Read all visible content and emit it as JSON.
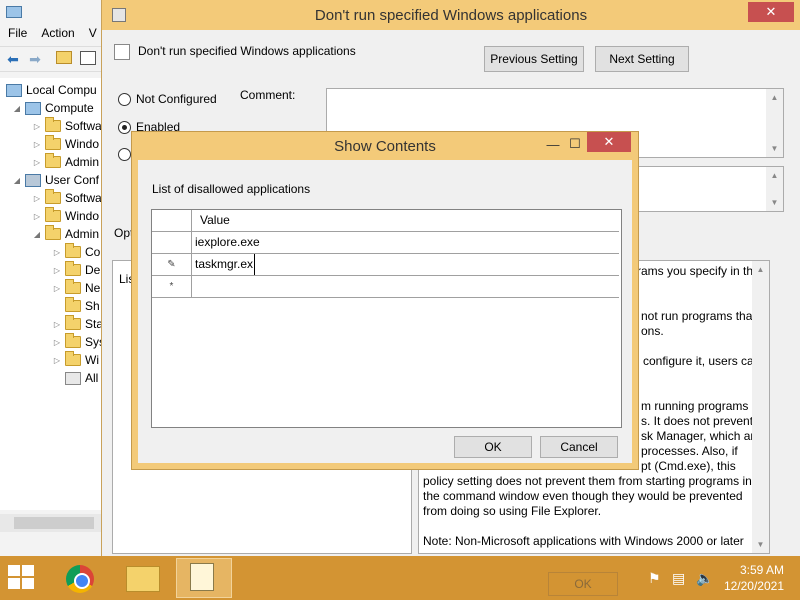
{
  "mmc": {
    "menu": [
      "File",
      "Action",
      "V"
    ],
    "tree": [
      {
        "label": "Local Compu",
        "icon": "computer-icon",
        "arrow": ""
      },
      {
        "label": "Compute",
        "icon": "computer-icon",
        "arrow": "down"
      },
      {
        "label": "Softwa",
        "icon": "folder-icon",
        "arrow": "right"
      },
      {
        "label": "Windo",
        "icon": "folder-icon",
        "arrow": "right"
      },
      {
        "label": "Admin",
        "icon": "folder-icon",
        "arrow": "right"
      },
      {
        "label": "User Conf",
        "icon": "user-icon",
        "arrow": "down"
      },
      {
        "label": "Softwa",
        "icon": "folder-icon",
        "arrow": "right"
      },
      {
        "label": "Windo",
        "icon": "folder-icon",
        "arrow": "right"
      },
      {
        "label": "Admin",
        "icon": "folder-icon",
        "arrow": "down"
      },
      {
        "label": "Co",
        "icon": "folder-icon",
        "arrow": "right"
      },
      {
        "label": "De",
        "icon": "folder-icon",
        "arrow": "right"
      },
      {
        "label": "Ne",
        "icon": "folder-icon",
        "arrow": "right"
      },
      {
        "label": "Sh",
        "icon": "folder-icon",
        "arrow": ""
      },
      {
        "label": "Sta",
        "icon": "folder-icon",
        "arrow": "right"
      },
      {
        "label": "Sys",
        "icon": "folder-icon",
        "arrow": "right"
      },
      {
        "label": "Wi",
        "icon": "folder-icon",
        "arrow": "right"
      },
      {
        "label": "All",
        "icon": "settings-icon",
        "arrow": ""
      }
    ]
  },
  "policy": {
    "window_title": "Don't run specified Windows applications",
    "header_title": "Don't run specified Windows applications",
    "prev_button": "Previous Setting",
    "next_button": "Next Setting",
    "options": {
      "not_configured": "Not Configured",
      "enabled": "Enabled",
      "selected": "enabled"
    },
    "comment_label": "Comment:",
    "options_label": "Opt",
    "list_label_fragment": "Lis",
    "help_lines": [
      "rams you specify in this",
      "not run programs that",
      "ons.",
      "configure it, users can",
      "m running programs",
      "s. It does not prevent",
      "sk Manager, which are",
      "processes.  Also, if",
      "pt (Cmd.exe), this",
      "policy setting does not prevent them from starting programs in",
      "the command window even though they would be prevented",
      "from doing so using File Explorer.",
      "Note: Non-Microsoft applications with Windows 2000 or later"
    ]
  },
  "dialog": {
    "title": "Show Contents",
    "list_label": "List of disallowed applications",
    "column_header": "Value",
    "rows": [
      {
        "marker": "",
        "value": "iexplore.exe"
      },
      {
        "marker": "✎",
        "value": "taskmgr.ex"
      },
      {
        "marker": "*",
        "value": ""
      }
    ],
    "ok_button": "OK",
    "cancel_button": "Cancel"
  },
  "window_controls": {
    "minimize": "—",
    "maximize": "☐",
    "close": "✕"
  },
  "taskbar": {
    "ghost_ok": "OK",
    "time": "3:59 AM",
    "date": "12/20/2021"
  },
  "colors": {
    "accent": "#f3ca79",
    "close": "#c75050",
    "taskbar": "#d39433"
  }
}
